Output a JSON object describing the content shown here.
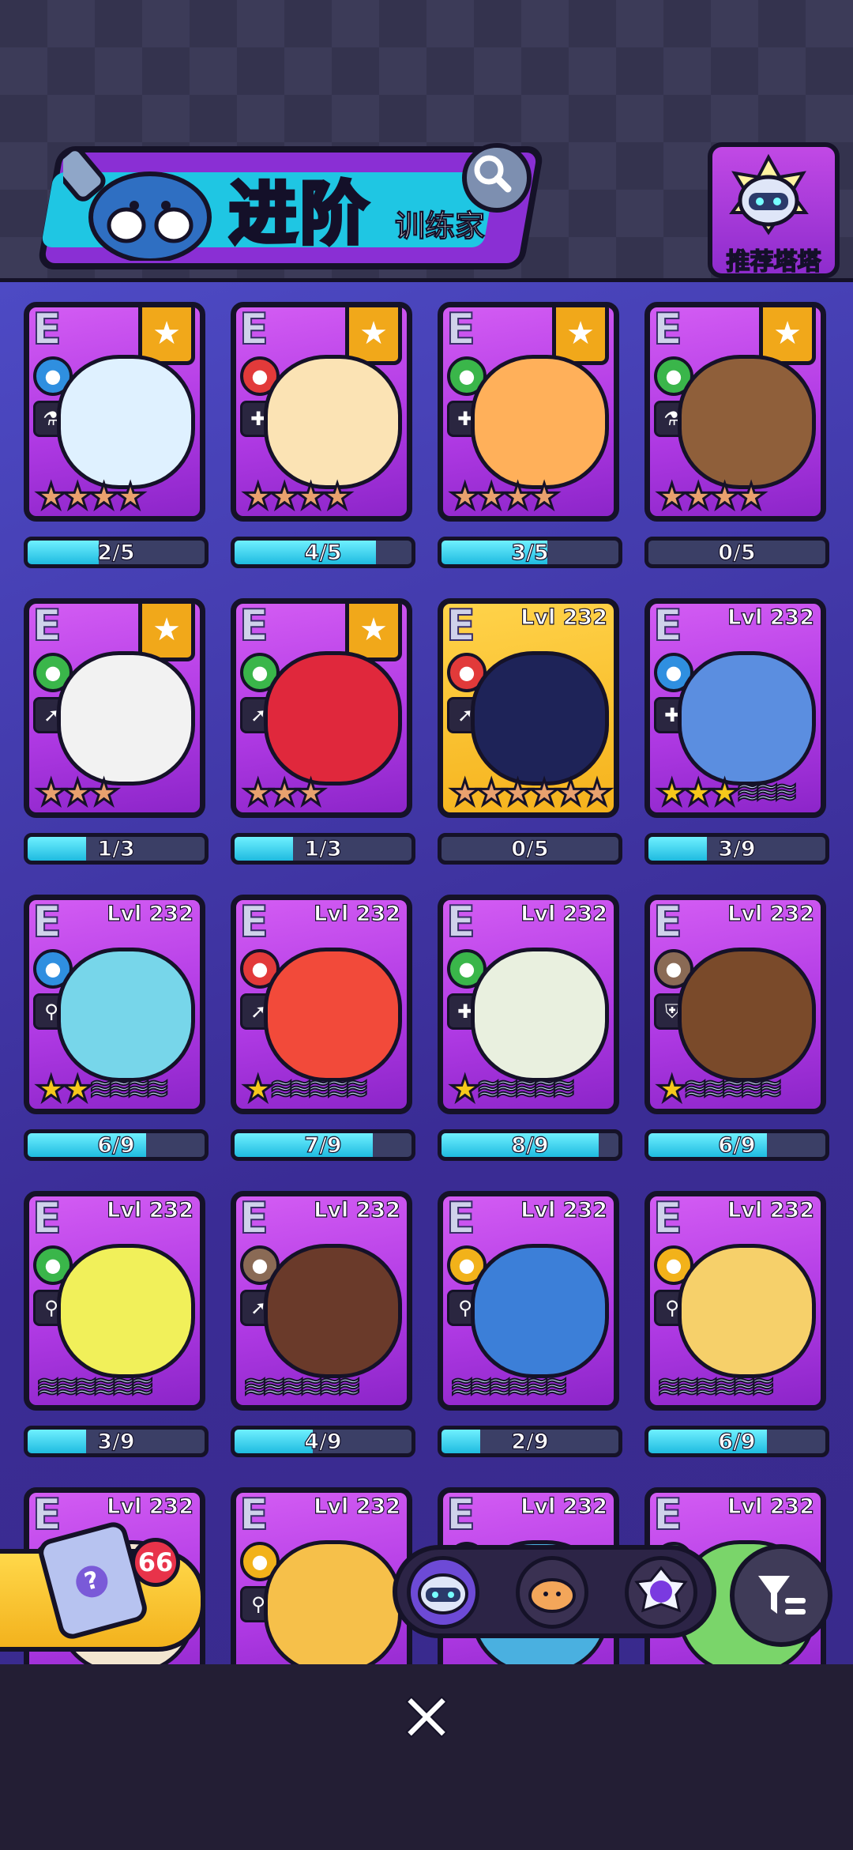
{
  "header": {
    "title": "进阶",
    "subtitle": "训练家",
    "recommend_label": "推荐塔塔"
  },
  "cards": [
    {
      "rank": "E",
      "element": "water",
      "role": "flask",
      "badge": "star",
      "level": "",
      "stars": 4,
      "star_type": "bronze",
      "creature_color": "#dff1ff",
      "progress_text": "2/5",
      "progress": 0.4
    },
    {
      "rank": "E",
      "element": "fire",
      "role": "plus",
      "badge": "star",
      "level": "",
      "stars": 4,
      "star_type": "bronze",
      "creature_color": "#fbe3b4",
      "progress_text": "4/5",
      "progress": 0.8
    },
    {
      "rank": "E",
      "element": "grass",
      "role": "plus",
      "badge": "star",
      "level": "",
      "stars": 4,
      "star_type": "bronze",
      "creature_color": "#ffb05a",
      "progress_text": "3/5",
      "progress": 0.6
    },
    {
      "rank": "E",
      "element": "grass",
      "role": "flask",
      "badge": "star",
      "level": "",
      "stars": 4,
      "star_type": "bronze",
      "creature_color": "#8f5f3a",
      "progress_text": "0/5",
      "progress": 0
    },
    {
      "rank": "E",
      "element": "grass",
      "role": "dash",
      "badge": "star",
      "level": "",
      "stars": 3,
      "star_type": "bronze",
      "creature_color": "#f2f2f2",
      "progress_text": "1/3",
      "progress": 0.33
    },
    {
      "rank": "E",
      "element": "grass",
      "role": "dash",
      "badge": "star",
      "level": "",
      "stars": 3,
      "star_type": "bronze",
      "creature_color": "#e0283c",
      "progress_text": "1/3",
      "progress": 0.33
    },
    {
      "rank": "E",
      "element": "fire",
      "role": "dash",
      "badge": "",
      "level": "Lvl 232",
      "stars": 6,
      "star_type": "bronze",
      "gold_bg": true,
      "creature_color": "#1e2358",
      "progress_text": "0/5",
      "progress": 0
    },
    {
      "rank": "E",
      "element": "water",
      "role": "plus",
      "badge": "",
      "level": "Lvl 232",
      "stars": 3,
      "star_type": "gold",
      "waves": 3,
      "creature_color": "#5b8ee0",
      "progress_text": "3/9",
      "progress": 0.33
    },
    {
      "rank": "E",
      "element": "water",
      "role": "bolt",
      "badge": "",
      "level": "Lvl 232",
      "stars": 2,
      "star_type": "gold",
      "waves": 4,
      "creature_color": "#77d6ea",
      "progress_text": "6/9",
      "progress": 0.67
    },
    {
      "rank": "E",
      "element": "fire",
      "role": "dash",
      "badge": "",
      "level": "Lvl 232",
      "stars": 1,
      "star_type": "gold",
      "waves": 5,
      "creature_color": "#f24a3a",
      "progress_text": "7/9",
      "progress": 0.78
    },
    {
      "rank": "E",
      "element": "grass",
      "role": "plus",
      "badge": "",
      "level": "Lvl 232",
      "stars": 1,
      "star_type": "gold",
      "waves": 5,
      "creature_color": "#e9f0df",
      "progress_text": "8/9",
      "progress": 0.89
    },
    {
      "rank": "E",
      "element": "earth",
      "role": "shield",
      "badge": "",
      "level": "Lvl 232",
      "stars": 1,
      "star_type": "gold",
      "waves": 5,
      "creature_color": "#7a4a2a",
      "progress_text": "6/9",
      "progress": 0.67
    },
    {
      "rank": "E",
      "element": "grass",
      "role": "bolt",
      "badge": "",
      "level": "Lvl 232",
      "stars": 0,
      "star_type": "gold",
      "waves": 6,
      "creature_color": "#f1f05a",
      "progress_text": "3/9",
      "progress": 0.33
    },
    {
      "rank": "E",
      "element": "earth",
      "role": "dash",
      "badge": "",
      "level": "Lvl 232",
      "stars": 0,
      "star_type": "gold",
      "waves": 6,
      "creature_color": "#6a3a2a",
      "progress_text": "4/9",
      "progress": 0.44
    },
    {
      "rank": "E",
      "element": "electric",
      "role": "bolt",
      "badge": "",
      "level": "Lvl 232",
      "stars": 0,
      "star_type": "gold",
      "waves": 6,
      "creature_color": "#3c7fd8",
      "progress_text": "2/9",
      "progress": 0.22
    },
    {
      "rank": "E",
      "element": "electric",
      "role": "bolt",
      "badge": "",
      "level": "Lvl 232",
      "stars": 0,
      "star_type": "gold",
      "waves": 6,
      "creature_color": "#f6d06a",
      "progress_text": "6/9",
      "progress": 0.67
    },
    {
      "rank": "E",
      "element": "fire",
      "role": "dash",
      "badge": "",
      "level": "Lvl 232",
      "stars": 0,
      "star_type": "gold",
      "waves": 0,
      "creature_color": "#f3e6d0",
      "progress_text": "",
      "progress": 0
    },
    {
      "rank": "E",
      "element": "electric",
      "role": "bolt",
      "badge": "",
      "level": "Lvl 232",
      "stars": 0,
      "star_type": "gold",
      "waves": 0,
      "creature_color": "#f6c04a",
      "progress_text": "",
      "progress": 0
    },
    {
      "rank": "E",
      "element": "electric",
      "role": "dash",
      "badge": "",
      "level": "Lvl 232",
      "stars": 0,
      "star_type": "gold",
      "waves": 0,
      "creature_color": "#4ab0e0",
      "progress_text": "",
      "progress": 0
    },
    {
      "rank": "E",
      "element": "grass",
      "role": "dash",
      "badge": "",
      "level": "Lvl 232",
      "stars": 0,
      "star_type": "gold",
      "waves": 0,
      "creature_color": "#7ad56a",
      "progress_text": "",
      "progress": 0
    }
  ],
  "gift": {
    "count": "66"
  },
  "element_colors": {
    "water": "#2f8fe0",
    "fire": "#e23a3a",
    "grass": "#3ab64a",
    "earth": "#8a6a55",
    "electric": "#f2b21a"
  },
  "role_glyphs": {
    "flask": "⚗",
    "plus": "✚",
    "dash": "➚",
    "bolt": "⚲",
    "shield": "⛨"
  },
  "bottom": {
    "close_glyph": "✕"
  }
}
